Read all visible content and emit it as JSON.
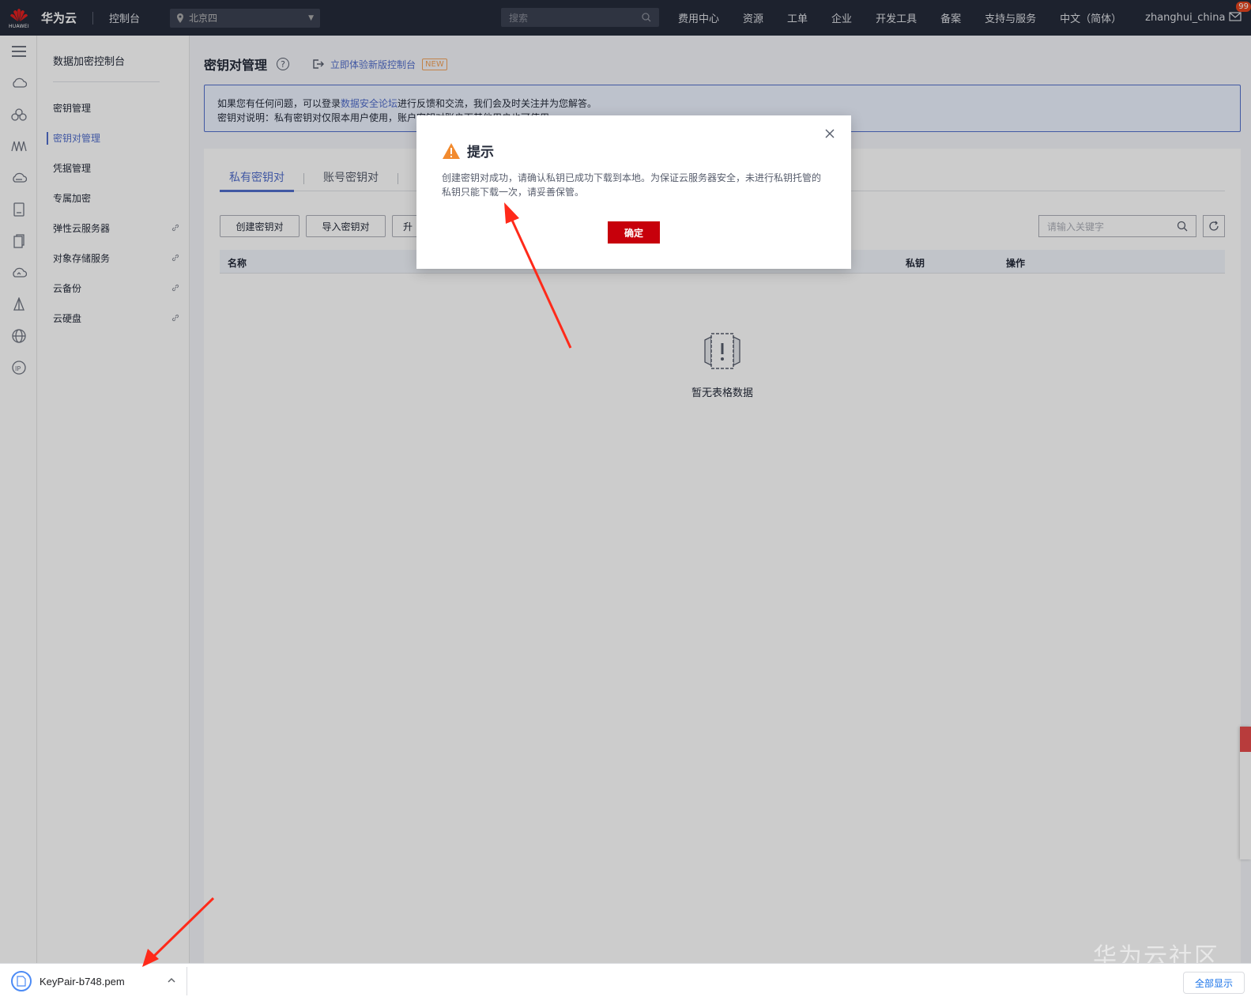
{
  "topbar": {
    "logo_text": "HUAWEI",
    "brand": "华为云",
    "console": "控制台",
    "region": "北京四",
    "search_placeholder": "搜索",
    "nav": [
      "费用中心",
      "资源",
      "工单",
      "企业",
      "开发工具",
      "备案",
      "支持与服务",
      "中文（简体）",
      "zhanghui_china"
    ],
    "mail_badge": "99"
  },
  "rail_icons": [
    "menu-icon",
    "cloud-icon",
    "cluster-icon",
    "chart-icon",
    "cloud-server-icon",
    "storage-icon",
    "document-icon",
    "cloud-sync-icon",
    "tower-icon",
    "globe-icon",
    "ip-icon"
  ],
  "menu": {
    "title": "数据加密控制台",
    "items": [
      {
        "label": "密钥管理",
        "active": false,
        "link": false
      },
      {
        "label": "密钥对管理",
        "active": true,
        "link": false
      },
      {
        "label": "凭据管理",
        "active": false,
        "link": false
      },
      {
        "label": "专属加密",
        "active": false,
        "link": false
      },
      {
        "label": "弹性云服务器",
        "active": false,
        "link": true
      },
      {
        "label": "对象存储服务",
        "active": false,
        "link": true
      },
      {
        "label": "云备份",
        "active": false,
        "link": true
      },
      {
        "label": "云硬盘",
        "active": false,
        "link": true
      }
    ]
  },
  "page": {
    "title": "密钥对管理",
    "help": "?",
    "try_new": "立即体验新版控制台",
    "new_badge": "NEW"
  },
  "notice": {
    "line1_pre": "如果您有任何问题，可以登录",
    "line1_link": "数据安全论坛",
    "line1_post": "进行反馈和交流，我们会及时关注并为您解答。",
    "line2": "密钥对说明：私有密钥对仅限本用户使用，账户密钥对账户下其他用户也可使用。"
  },
  "tabs": [
    {
      "label": "私有密钥对",
      "active": true
    },
    {
      "label": "账号密钥对",
      "active": false
    }
  ],
  "toolbar": {
    "create": "创建密钥对",
    "import": "导入密钥对",
    "third": "further",
    "third_visible": "升",
    "search_placeholder": "请输入关键字"
  },
  "table": {
    "columns": [
      "名称",
      "私钥",
      "操作"
    ]
  },
  "empty": {
    "text": "暂无表格数据"
  },
  "dialog": {
    "title": "提示",
    "body": "创建密钥对成功，请确认私钥已成功下载到本地。为保证云服务器安全，未进行私钥托管的私钥只能下载一次，请妥善保管。",
    "confirm": "确定"
  },
  "download": {
    "file": "KeyPair-b748.pem",
    "show_all": "全部显示"
  },
  "watermark": "华为云社区",
  "colors": {
    "topbar": "#252b3a",
    "accent": "#526ecc",
    "danger": "#c7000b",
    "warning": "#f66f6a",
    "arrow": "#ff2a1a"
  }
}
